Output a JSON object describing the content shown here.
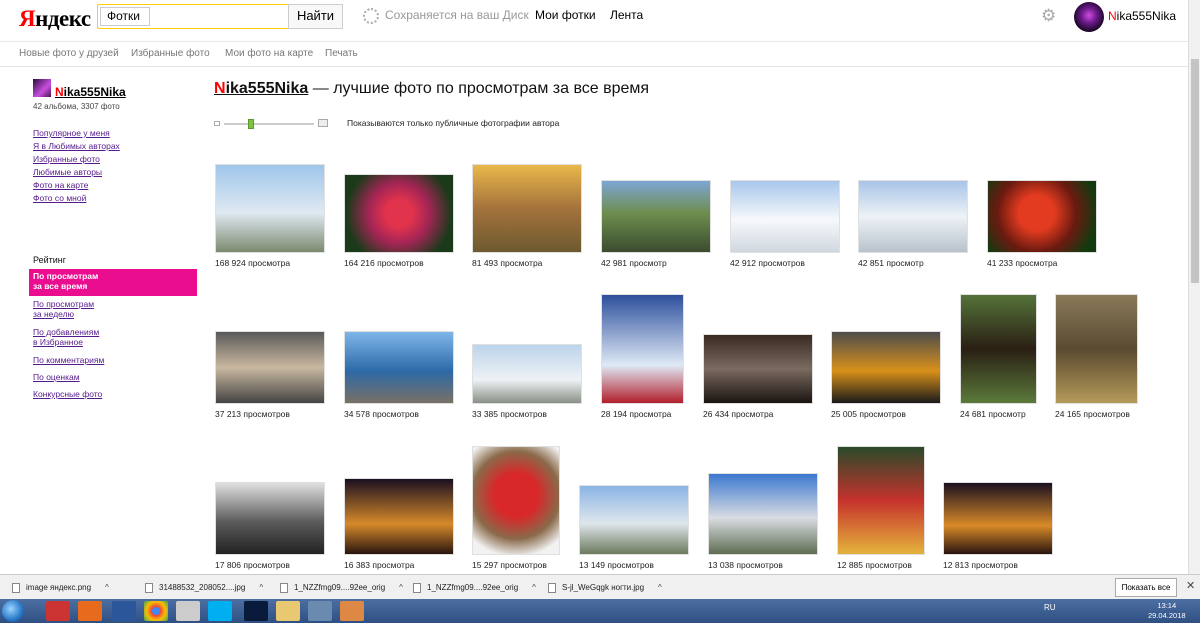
{
  "header": {
    "logo": {
      "y": "Я",
      "rest": "ндекс"
    },
    "search_tag": "Фотки",
    "search_value": "",
    "search_button": "Найти",
    "saving_text": "Сохраняется на ваш Диск",
    "nav": [
      "Мои фотки",
      "Лента"
    ],
    "user": {
      "first": "N",
      "rest": "ika555Nika"
    }
  },
  "subnav": [
    "Новые фото у друзей",
    "Избранные фото",
    "Мои фото на карте",
    "Печать"
  ],
  "profile": {
    "name_first": "N",
    "name_rest": "ika555Nika",
    "counts": "42 альбома, 3307 фото",
    "links": [
      "Популярное у меня",
      "Я в Любимых авторах",
      "Избранные фото",
      "Любимые авторы",
      "Фото на карте",
      "Фото со мной"
    ]
  },
  "rating": {
    "title": "Рейтинг",
    "active": {
      "line1": "По просмотрам",
      "line2": "за все время"
    },
    "links": [
      {
        "line1": "По просмотрам",
        "line2": "за неделю"
      },
      {
        "line1": "По добавлениям",
        "line2": "в Избранное"
      },
      {
        "line1": "По комментариям",
        "line2": ""
      },
      {
        "line1": "По оценкам",
        "line2": ""
      },
      {
        "line1": "Конкурсные фото",
        "line2": ""
      }
    ]
  },
  "main": {
    "title_user_first": "N",
    "title_user_rest": "ika555Nika",
    "title_text": " — лучшие фото по просмотрам за все время",
    "public_note": "Показываются только публичные фотографии автора",
    "slider_level": 0.3
  },
  "photos": [
    {
      "views": "168 924 просмотра",
      "icon": "church-photo"
    },
    {
      "views": "164 216 просмотров",
      "icon": "rose-photo"
    },
    {
      "views": "81 493 просмотра",
      "icon": "wooden-house-photo"
    },
    {
      "views": "42 981 просмотр",
      "icon": "cyclists-photo"
    },
    {
      "views": "42 912 просмотров",
      "icon": "snow-slope-photo"
    },
    {
      "views": "42 851 просмотр",
      "icon": "snowmobile-photo"
    },
    {
      "views": "41 233 просмотра",
      "icon": "red-lily-photo"
    },
    {
      "views": "37 213 просмотров",
      "icon": "reflection-photo"
    },
    {
      "views": "34 578 просмотров",
      "icon": "palm-embankment-photo"
    },
    {
      "views": "33 385 просмотров",
      "icon": "winter-trees-photo"
    },
    {
      "views": "28 194 просмотра",
      "icon": "snowman-photo"
    },
    {
      "views": "26 434 просмотра",
      "icon": "dog-sleeping-photo"
    },
    {
      "views": "25 005 просмотров",
      "icon": "sunset-photo"
    },
    {
      "views": "24 681 просмотр",
      "icon": "dachshund-portrait-photo"
    },
    {
      "views": "24 165 просмотров",
      "icon": "dachshund-forest-photo"
    },
    {
      "views": "17 806 просмотров",
      "icon": "bw-street-photo"
    },
    {
      "views": "16 383 просмотра",
      "icon": "night-lights-photo"
    },
    {
      "views": "15 297 просмотров",
      "icon": "tomato-sculpture-photo"
    },
    {
      "views": "13 149 просмотров",
      "icon": "station-photo"
    },
    {
      "views": "13 038 просмотров",
      "icon": "building-photo"
    },
    {
      "views": "12 885 просмотров",
      "icon": "dancers-photo"
    },
    {
      "views": "12 813 просмотров",
      "icon": "night-lights-2-photo"
    }
  ],
  "downloads": [
    "image яндекс.png",
    "31488532_208052....jpg",
    "1_NZZfmg09....92ee_orig",
    "1_NZZfmg09....92ee_orig",
    "S-jl_WeGqgk ногти.jpg"
  ],
  "downloads_show_all": "Показать все",
  "tray": {
    "lang": "RU",
    "time": "13:14",
    "date": "29.04.2018"
  }
}
